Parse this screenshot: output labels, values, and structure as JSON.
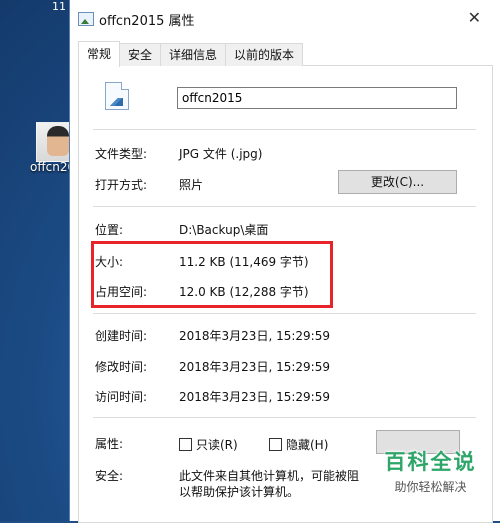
{
  "desktop": {
    "corner_text": "11",
    "icon_label": "offcn20"
  },
  "window": {
    "title": "offcn2015 属性",
    "close_symbol": "✕"
  },
  "tabs": [
    "常规",
    "安全",
    "详细信息",
    "以前的版本"
  ],
  "general": {
    "file_name": "offcn2015",
    "file_type_label": "文件类型:",
    "file_type_value": "JPG 文件 (.jpg)",
    "open_with_label": "打开方式:",
    "open_with_value": "照片",
    "change_button": "更改(C)...",
    "location_label": "位置:",
    "location_value": "D:\\Backup\\桌面",
    "size_label": "大小:",
    "size_value": "11.2 KB (11,469 字节)",
    "size_on_disk_label": "占用空间:",
    "size_on_disk_value": "12.0 KB (12,288 字节)",
    "created_label": "创建时间:",
    "created_value": "2018年3月23日, 15:29:59",
    "modified_label": "修改时间:",
    "modified_value": "2018年3月23日, 15:29:59",
    "accessed_label": "访问时间:",
    "accessed_value": "2018年3月23日, 15:29:59",
    "attributes_label": "属性:",
    "readonly_label": "只读(R)",
    "hidden_label": "隐藏(H)",
    "security_label": "安全:",
    "security_text_line1": "此文件来自其他计算机，可能被阻",
    "security_text_line2": "以帮助保护该计算机。"
  },
  "watermark": {
    "title": "百科全说",
    "subtitle": "助你轻松解决"
  },
  "colors": {
    "highlight_border": "#e8242a",
    "watermark_green": "#2ea66a"
  }
}
